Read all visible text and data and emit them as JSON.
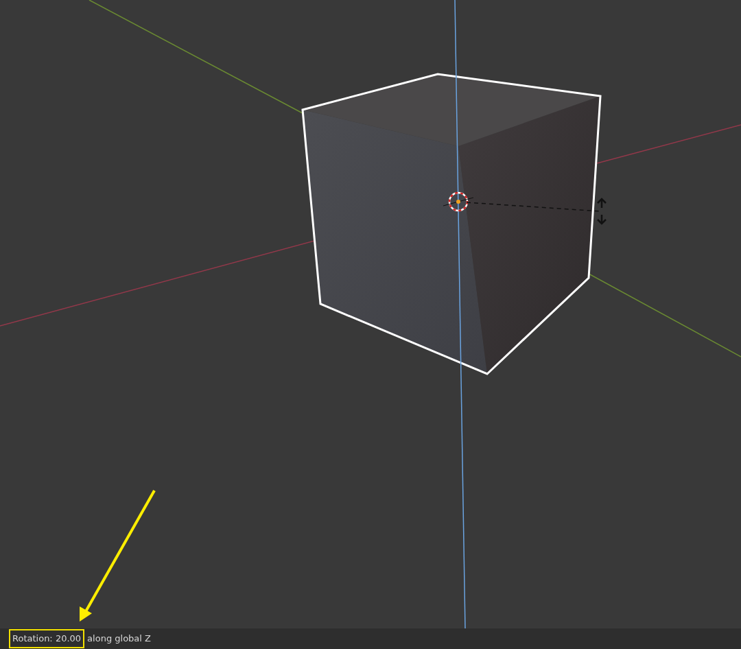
{
  "status_bar": {
    "highlighted_text": "Rotation: 20.00",
    "text": "along global Z"
  }
}
